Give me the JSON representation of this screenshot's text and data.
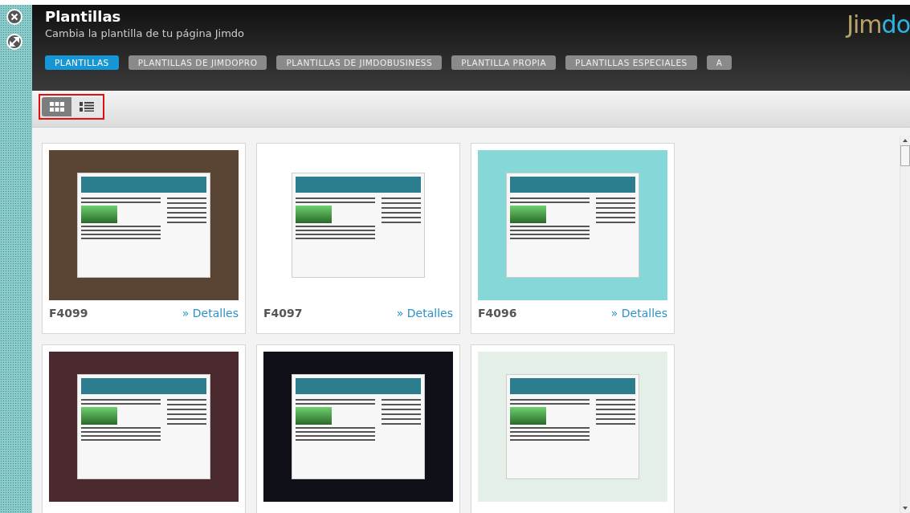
{
  "header": {
    "title": "Plantillas",
    "subtitle": "Cambia la plantilla de tu página Jimdo",
    "logo": {
      "part_1": "Jim",
      "part_2": "do"
    }
  },
  "tabs": [
    {
      "label": "PLANTILLAS",
      "selected": true
    },
    {
      "label": "PLANTILLAS DE JIMDOPRO",
      "selected": false
    },
    {
      "label": "PLANTILLAS DE JIMDOBUSINESS",
      "selected": false
    },
    {
      "label": "PLANTILLA PROPIA",
      "selected": false
    },
    {
      "label": "PLANTILLAS ESPECIALES",
      "selected": false
    },
    {
      "label": "A",
      "selected": false
    }
  ],
  "view_toggle": [
    {
      "kind": "grid",
      "selected": true
    },
    {
      "kind": "list",
      "selected": false
    }
  ],
  "templates": [
    {
      "name": "F4099",
      "link": "» Detalles",
      "color": "#5a4535"
    },
    {
      "name": "F4097",
      "link": "» Detalles",
      "color": "#ffffff"
    },
    {
      "name": "F4096",
      "link": "» Detalles",
      "color": "#86d8d8"
    },
    {
      "color": "#4a2a2e"
    },
    {
      "color": "#101018"
    },
    {
      "color": "#e4efe8"
    }
  ]
}
